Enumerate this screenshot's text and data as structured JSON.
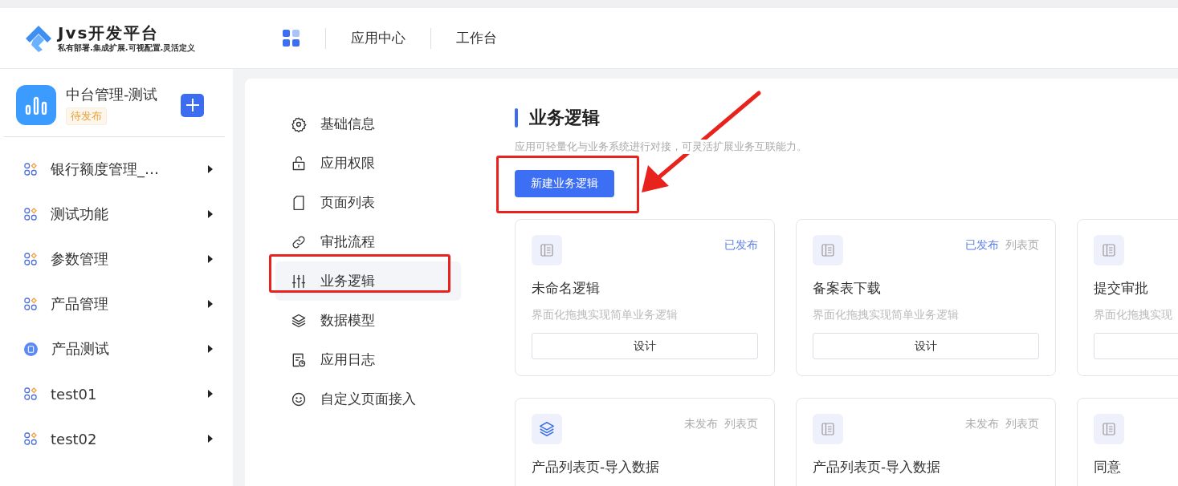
{
  "header": {
    "logo_title": "Jvs开发平台",
    "logo_subtitle": "私有部署.集成扩展.可视配置.灵活定义",
    "nav": [
      "应用中心",
      "工作台"
    ]
  },
  "sidebar": {
    "app_name": "中台管理-测试",
    "app_status": "待发布",
    "items": [
      {
        "label": "银行额度管理_…",
        "kind": "module"
      },
      {
        "label": "测试功能",
        "kind": "module"
      },
      {
        "label": "参数管理",
        "kind": "module"
      },
      {
        "label": "产品管理",
        "kind": "module"
      },
      {
        "label": "产品测试",
        "kind": "page"
      },
      {
        "label": "test01",
        "kind": "module"
      },
      {
        "label": "test02",
        "kind": "module"
      }
    ]
  },
  "settings_menu": [
    {
      "label": "基础信息",
      "kind": "gear",
      "selected": false
    },
    {
      "label": "应用权限",
      "kind": "lock",
      "selected": false
    },
    {
      "label": "页面列表",
      "kind": "page",
      "selected": false
    },
    {
      "label": "审批流程",
      "kind": "link",
      "selected": false
    },
    {
      "label": "业务逻辑",
      "kind": "sliders",
      "selected": true
    },
    {
      "label": "数据模型",
      "kind": "layers",
      "selected": false
    },
    {
      "label": "应用日志",
      "kind": "log",
      "selected": false
    },
    {
      "label": "自定义页面接入",
      "kind": "smile",
      "selected": false
    }
  ],
  "content": {
    "title": "业务逻辑",
    "description": "应用可轻量化与业务系统进行对接，可灵活扩展业务互联能力。",
    "new_button": "新建业务逻辑",
    "cards": [
      {
        "kind": "form",
        "status": "已发布",
        "published": true,
        "title": "未命名逻辑",
        "description": "界面化拖拽实现简单业务逻辑",
        "button": "设计"
      },
      {
        "kind": "form",
        "status": "已发布",
        "published": true,
        "type": "列表页",
        "title": "备案表下载",
        "description": "界面化拖拽实现简单业务逻辑",
        "button": "设计"
      },
      {
        "kind": "form",
        "title": "提交审批",
        "description": "界面化拖拽实现",
        "button_shown": true
      },
      {
        "kind": "layers",
        "status": "未发布",
        "published": false,
        "type": "列表页",
        "title": "产品列表页-导入数据"
      },
      {
        "kind": "form",
        "status": "未发布",
        "published": false,
        "type": "列表页",
        "title": "产品列表页-导入数据"
      },
      {
        "kind": "form",
        "title": "同意"
      }
    ]
  }
}
